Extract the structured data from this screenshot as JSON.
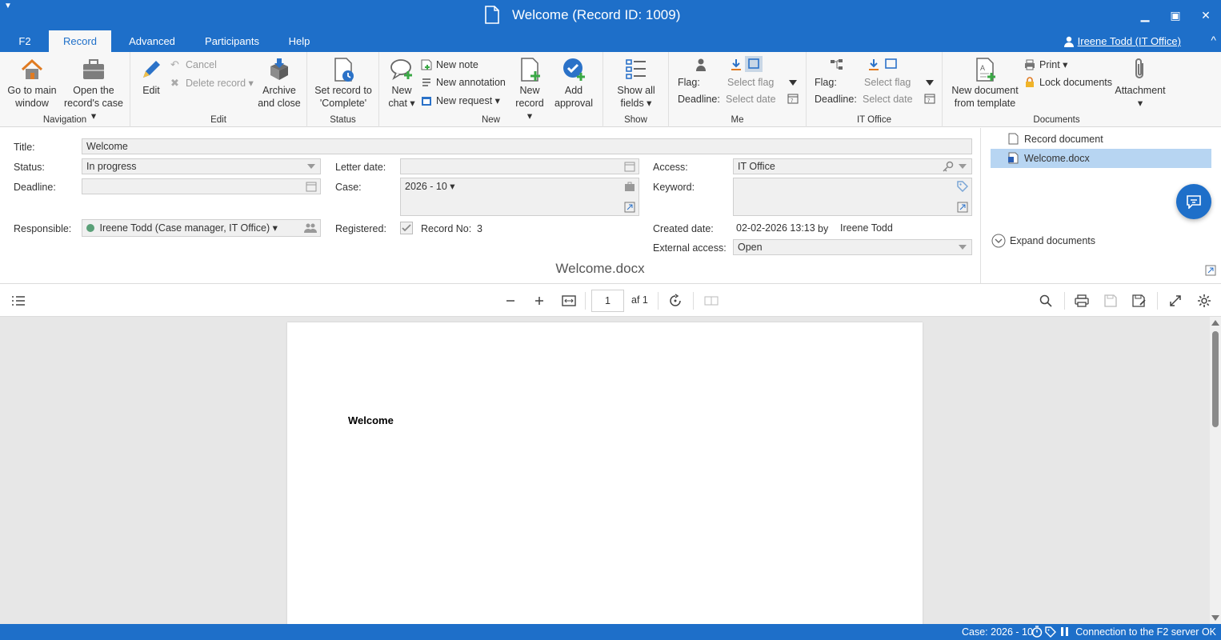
{
  "window": {
    "title": "Welcome (Record ID: 1009)",
    "minimize": "▁",
    "maximize": "▣",
    "close": "✕",
    "sysmenu": "▼"
  },
  "menu": {
    "tabs": [
      "F2",
      "Record",
      "Advanced",
      "Participants",
      "Help"
    ],
    "active": "Record",
    "user": "Ireene Todd (IT Office)",
    "collapse": "^"
  },
  "ribbon": {
    "navigation": {
      "title": "Navigation",
      "go_main_l1": "Go to main",
      "go_main_l2": "window",
      "open_case_l1": "Open the",
      "open_case_l2": "record's case ▾"
    },
    "edit": {
      "title": "Edit",
      "edit": "Edit",
      "cancel": "Cancel",
      "delete": "Delete record ▾",
      "archive_l1": "Archive",
      "archive_l2": "and close"
    },
    "status": {
      "title": "Status",
      "set_l1": "Set record to",
      "set_l2": "'Complete'"
    },
    "new": {
      "title": "New",
      "chat_l1": "New",
      "chat_l2": "chat ▾",
      "note": "New note",
      "annotation": "New annotation",
      "request": "New request ▾",
      "record_l1": "New",
      "record_l2": "record ▾",
      "approval_l1": "Add",
      "approval_l2": "approval"
    },
    "show": {
      "title": "Show",
      "fields_l1": "Show all",
      "fields_l2": "fields ▾"
    },
    "me": {
      "title": "Me",
      "flag_label": "Flag:",
      "deadline_label": "Deadline:",
      "flag_value": "Select flag",
      "deadline_value": "Select date"
    },
    "itoffice": {
      "title": "IT Office",
      "flag_label": "Flag:",
      "deadline_label": "Deadline:",
      "flag_value": "Select flag",
      "deadline_value": "Select date"
    },
    "documents": {
      "title": "Documents",
      "newdoc_l1": "New document",
      "newdoc_l2": "from template",
      "print": "Print ▾",
      "lock": "Lock documents",
      "attachment": "Attachment",
      "attachment_arrow": "▾"
    }
  },
  "form": {
    "title_label": "Title:",
    "title_value": "Welcome",
    "status_label": "Status:",
    "status_value": "In progress",
    "deadline_label": "Deadline:",
    "responsible_label": "Responsible:",
    "responsible_value": "Ireene Todd (Case manager, IT Office) ▾",
    "letter_date_label": "Letter date:",
    "case_label": "Case:",
    "case_value": "2026 - 10 ▾",
    "registered_label": "Registered:",
    "record_no_label": "Record No:",
    "record_no_value": "3",
    "access_label": "Access:",
    "access_value": "IT Office",
    "keyword_label": "Keyword:",
    "created_label": "Created date:",
    "created_value": "02-02-2026 13:13",
    "by_label": "by",
    "created_by": "Ireene Todd",
    "external_label": "External access:",
    "external_value": "Open"
  },
  "documents": {
    "items": [
      "Record document",
      "Welcome.docx"
    ],
    "selected": "Welcome.docx",
    "expand": "Expand documents"
  },
  "viewer": {
    "doc_title": "Welcome.docx",
    "page_current": "1",
    "page_of": "af 1",
    "page_heading": "Welcome"
  },
  "statusbar": {
    "case": "Case: 2026 - 10",
    "connection": "Connection to the F2 server OK"
  },
  "colors": {
    "brand": "#1e6fc9",
    "selection": "#b7d5f2"
  }
}
